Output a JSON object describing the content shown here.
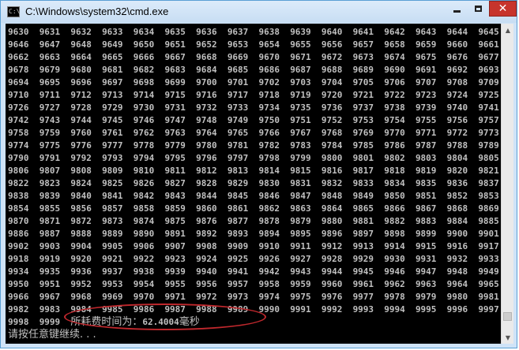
{
  "window": {
    "title": "C:\\Windows\\system32\\cmd.exe",
    "icon": "cmd-icon",
    "buttons": {
      "minimize": "minimize-icon",
      "maximize": "maximize-icon",
      "close": "close-icon"
    }
  },
  "console": {
    "numbers_start": 9630,
    "numbers_end": 9999,
    "columns": 16,
    "elapsed_label": "所耗费时间为：",
    "elapsed_value": "62.4004",
    "elapsed_unit": "毫秒",
    "prompt": "请按任意键继续. . ."
  },
  "scrollbar": {
    "thumb_position": 0.965,
    "thumb_size": 0.03
  },
  "colors": {
    "console_bg": "#000000",
    "console_text": "#c0c0c0",
    "annotation": "#c0282d",
    "close_button": "#c7342c"
  }
}
